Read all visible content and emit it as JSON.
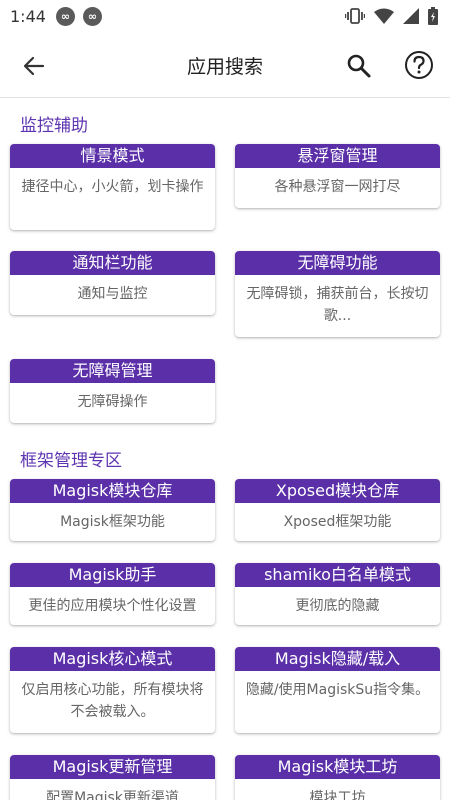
{
  "status": {
    "time": "1:44",
    "badges": [
      "∞",
      "∞"
    ]
  },
  "header": {
    "title": "应用搜索",
    "icons": [
      "back-arrow-icon",
      "search-icon",
      "help-icon"
    ]
  },
  "sections": [
    {
      "title": "监控辅助",
      "cards": [
        {
          "title": "情景模式",
          "desc": "捷径中心，小火箭，划卡操作"
        },
        {
          "title": "悬浮窗管理",
          "desc": "各种悬浮窗一网打尽"
        },
        {
          "title": "通知栏功能",
          "desc": "通知与监控"
        },
        {
          "title": "无障碍功能",
          "desc": "无障碍锁，捕获前台，长按切歌..."
        },
        {
          "title": "无障碍管理",
          "desc": "无障碍操作"
        }
      ]
    },
    {
      "title": "框架管理专区",
      "cards": [
        {
          "title": "Magisk模块仓库",
          "desc": "Magisk框架功能"
        },
        {
          "title": "Xposed模块仓库",
          "desc": "Xposed框架功能"
        },
        {
          "title": "Magisk助手",
          "desc": "更佳的应用模块个性化设置"
        },
        {
          "title": "shamiko白名单模式",
          "desc": "更彻底的隐藏"
        },
        {
          "title": "Magisk核心模式",
          "desc": "仅启用核心功能，所有模块将不会被载入。"
        },
        {
          "title": "Magisk隐藏/载入",
          "desc": "隐藏/使用MagiskSu指令集。"
        },
        {
          "title": "Magisk更新管理",
          "desc": "配置Magisk更新渠道"
        },
        {
          "title": "Magisk模块工坊",
          "desc": "模块工坊"
        }
      ]
    }
  ]
}
